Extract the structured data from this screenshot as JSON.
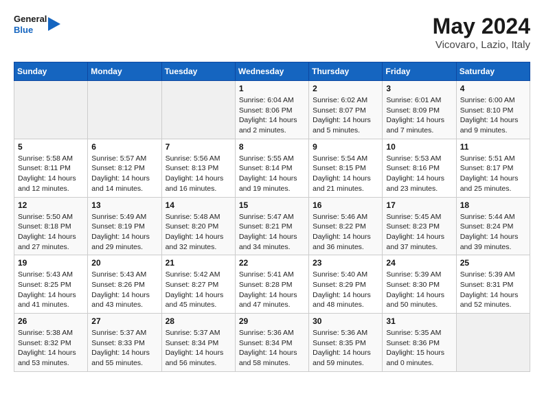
{
  "header": {
    "logo_line1": "General",
    "logo_line2": "Blue",
    "month_year": "May 2024",
    "location": "Vicovaro, Lazio, Italy"
  },
  "days_of_week": [
    "Sunday",
    "Monday",
    "Tuesday",
    "Wednesday",
    "Thursday",
    "Friday",
    "Saturday"
  ],
  "weeks": [
    [
      {
        "day": "",
        "sunrise": "",
        "sunset": "",
        "daylight": "",
        "empty": true
      },
      {
        "day": "",
        "sunrise": "",
        "sunset": "",
        "daylight": "",
        "empty": true
      },
      {
        "day": "",
        "sunrise": "",
        "sunset": "",
        "daylight": "",
        "empty": true
      },
      {
        "day": "1",
        "sunrise": "Sunrise: 6:04 AM",
        "sunset": "Sunset: 8:06 PM",
        "daylight": "Daylight: 14 hours and 2 minutes."
      },
      {
        "day": "2",
        "sunrise": "Sunrise: 6:02 AM",
        "sunset": "Sunset: 8:07 PM",
        "daylight": "Daylight: 14 hours and 5 minutes."
      },
      {
        "day": "3",
        "sunrise": "Sunrise: 6:01 AM",
        "sunset": "Sunset: 8:09 PM",
        "daylight": "Daylight: 14 hours and 7 minutes."
      },
      {
        "day": "4",
        "sunrise": "Sunrise: 6:00 AM",
        "sunset": "Sunset: 8:10 PM",
        "daylight": "Daylight: 14 hours and 9 minutes."
      }
    ],
    [
      {
        "day": "5",
        "sunrise": "Sunrise: 5:58 AM",
        "sunset": "Sunset: 8:11 PM",
        "daylight": "Daylight: 14 hours and 12 minutes."
      },
      {
        "day": "6",
        "sunrise": "Sunrise: 5:57 AM",
        "sunset": "Sunset: 8:12 PM",
        "daylight": "Daylight: 14 hours and 14 minutes."
      },
      {
        "day": "7",
        "sunrise": "Sunrise: 5:56 AM",
        "sunset": "Sunset: 8:13 PM",
        "daylight": "Daylight: 14 hours and 16 minutes."
      },
      {
        "day": "8",
        "sunrise": "Sunrise: 5:55 AM",
        "sunset": "Sunset: 8:14 PM",
        "daylight": "Daylight: 14 hours and 19 minutes."
      },
      {
        "day": "9",
        "sunrise": "Sunrise: 5:54 AM",
        "sunset": "Sunset: 8:15 PM",
        "daylight": "Daylight: 14 hours and 21 minutes."
      },
      {
        "day": "10",
        "sunrise": "Sunrise: 5:53 AM",
        "sunset": "Sunset: 8:16 PM",
        "daylight": "Daylight: 14 hours and 23 minutes."
      },
      {
        "day": "11",
        "sunrise": "Sunrise: 5:51 AM",
        "sunset": "Sunset: 8:17 PM",
        "daylight": "Daylight: 14 hours and 25 minutes."
      }
    ],
    [
      {
        "day": "12",
        "sunrise": "Sunrise: 5:50 AM",
        "sunset": "Sunset: 8:18 PM",
        "daylight": "Daylight: 14 hours and 27 minutes."
      },
      {
        "day": "13",
        "sunrise": "Sunrise: 5:49 AM",
        "sunset": "Sunset: 8:19 PM",
        "daylight": "Daylight: 14 hours and 29 minutes."
      },
      {
        "day": "14",
        "sunrise": "Sunrise: 5:48 AM",
        "sunset": "Sunset: 8:20 PM",
        "daylight": "Daylight: 14 hours and 32 minutes."
      },
      {
        "day": "15",
        "sunrise": "Sunrise: 5:47 AM",
        "sunset": "Sunset: 8:21 PM",
        "daylight": "Daylight: 14 hours and 34 minutes."
      },
      {
        "day": "16",
        "sunrise": "Sunrise: 5:46 AM",
        "sunset": "Sunset: 8:22 PM",
        "daylight": "Daylight: 14 hours and 36 minutes."
      },
      {
        "day": "17",
        "sunrise": "Sunrise: 5:45 AM",
        "sunset": "Sunset: 8:23 PM",
        "daylight": "Daylight: 14 hours and 37 minutes."
      },
      {
        "day": "18",
        "sunrise": "Sunrise: 5:44 AM",
        "sunset": "Sunset: 8:24 PM",
        "daylight": "Daylight: 14 hours and 39 minutes."
      }
    ],
    [
      {
        "day": "19",
        "sunrise": "Sunrise: 5:43 AM",
        "sunset": "Sunset: 8:25 PM",
        "daylight": "Daylight: 14 hours and 41 minutes."
      },
      {
        "day": "20",
        "sunrise": "Sunrise: 5:43 AM",
        "sunset": "Sunset: 8:26 PM",
        "daylight": "Daylight: 14 hours and 43 minutes."
      },
      {
        "day": "21",
        "sunrise": "Sunrise: 5:42 AM",
        "sunset": "Sunset: 8:27 PM",
        "daylight": "Daylight: 14 hours and 45 minutes."
      },
      {
        "day": "22",
        "sunrise": "Sunrise: 5:41 AM",
        "sunset": "Sunset: 8:28 PM",
        "daylight": "Daylight: 14 hours and 47 minutes."
      },
      {
        "day": "23",
        "sunrise": "Sunrise: 5:40 AM",
        "sunset": "Sunset: 8:29 PM",
        "daylight": "Daylight: 14 hours and 48 minutes."
      },
      {
        "day": "24",
        "sunrise": "Sunrise: 5:39 AM",
        "sunset": "Sunset: 8:30 PM",
        "daylight": "Daylight: 14 hours and 50 minutes."
      },
      {
        "day": "25",
        "sunrise": "Sunrise: 5:39 AM",
        "sunset": "Sunset: 8:31 PM",
        "daylight": "Daylight: 14 hours and 52 minutes."
      }
    ],
    [
      {
        "day": "26",
        "sunrise": "Sunrise: 5:38 AM",
        "sunset": "Sunset: 8:32 PM",
        "daylight": "Daylight: 14 hours and 53 minutes."
      },
      {
        "day": "27",
        "sunrise": "Sunrise: 5:37 AM",
        "sunset": "Sunset: 8:33 PM",
        "daylight": "Daylight: 14 hours and 55 minutes."
      },
      {
        "day": "28",
        "sunrise": "Sunrise: 5:37 AM",
        "sunset": "Sunset: 8:34 PM",
        "daylight": "Daylight: 14 hours and 56 minutes."
      },
      {
        "day": "29",
        "sunrise": "Sunrise: 5:36 AM",
        "sunset": "Sunset: 8:34 PM",
        "daylight": "Daylight: 14 hours and 58 minutes."
      },
      {
        "day": "30",
        "sunrise": "Sunrise: 5:36 AM",
        "sunset": "Sunset: 8:35 PM",
        "daylight": "Daylight: 14 hours and 59 minutes."
      },
      {
        "day": "31",
        "sunrise": "Sunrise: 5:35 AM",
        "sunset": "Sunset: 8:36 PM",
        "daylight": "Daylight: 15 hours and 0 minutes."
      },
      {
        "day": "",
        "sunrise": "",
        "sunset": "",
        "daylight": "",
        "empty": true
      }
    ]
  ]
}
